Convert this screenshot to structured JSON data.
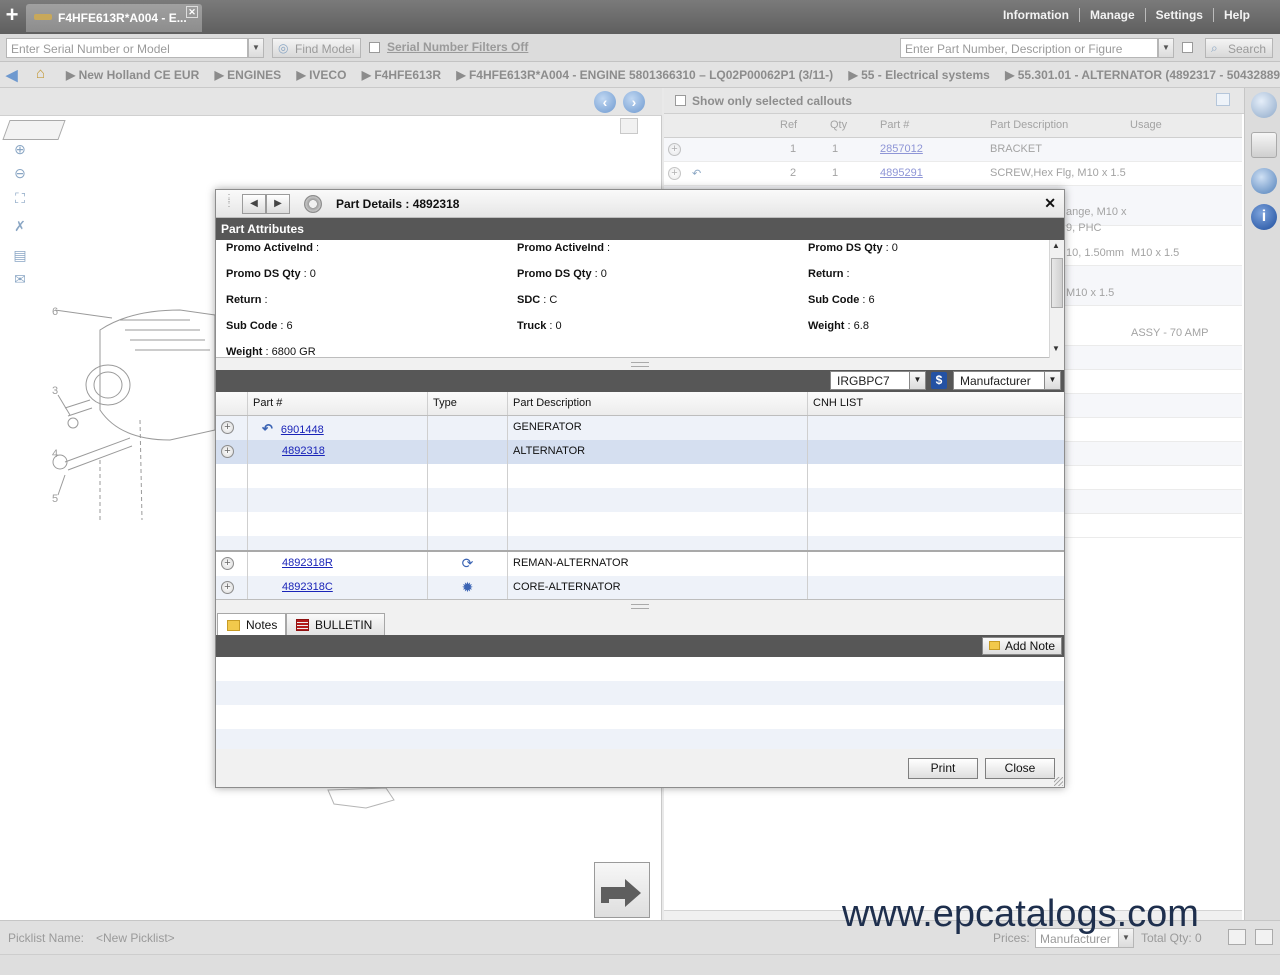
{
  "app": {
    "tab_title": "F4HFE613R*A004 - E...",
    "menu": [
      "Information",
      "Manage",
      "Settings",
      "Help"
    ]
  },
  "search": {
    "serial_placeholder": "Enter Serial Number or Model",
    "find_model": "Find Model",
    "serial_filters": "Serial Number Filters Off",
    "part_placeholder": "Enter Part Number, Description or Figure",
    "search_label": "Search"
  },
  "breadcrumb": [
    "New Holland CE EUR",
    "ENGINES",
    "IVECO",
    "F4HFE613R",
    "F4HFE613R*A004 - ENGINE 5801366310 – LQ02P00062P1 (3/11-)",
    "55 - Electrical systems",
    "55.301.01 - ALTERNATOR (4892317 - 504328894)"
  ],
  "diagram": {
    "callouts": [
      "6",
      "3",
      "4",
      "5"
    ]
  },
  "callout_panel": {
    "show_only_selected": "Show only selected callouts",
    "columns": [
      "Ref",
      "Qty",
      "Part #",
      "Part Description",
      "Usage"
    ],
    "rows": [
      {
        "ref": "1",
        "qty": "1",
        "part": "2857012",
        "desc": "BRACKET",
        "usage": ""
      },
      {
        "ref": "2",
        "qty": "1",
        "part": "4895291",
        "desc": "SCREW,Hex Flg, M10 x 1.5",
        "usage": ""
      }
    ],
    "fragments": [
      "ange, M10 x",
      "9, PHC",
      "10, 1.50mm",
      "M10 x 1.5",
      "M10 x 1.5",
      "ASSY - 70 AMP"
    ]
  },
  "picklist": {
    "label": "Picklist Name:",
    "value": "<New Picklist>",
    "prices_label": "Prices:",
    "prices_value": "Manufacturer",
    "total_qty": "Total Qty: 0"
  },
  "watermark": "www.epcatalogs.com",
  "modal": {
    "title": "Part Details : 4892318",
    "attributes_header": "Part Attributes",
    "attributes": [
      {
        "label": "Promo ActiveInd",
        "value": ""
      },
      {
        "label": "Promo ActiveInd",
        "value": ""
      },
      {
        "label": "Promo DS Qty",
        "value": "0"
      },
      {
        "label": "Promo DS Qty",
        "value": "0"
      },
      {
        "label": "Promo DS Qty",
        "value": "0"
      },
      {
        "label": "Return",
        "value": ""
      },
      {
        "label": "Return",
        "value": ""
      },
      {
        "label": "SDC",
        "value": "C"
      },
      {
        "label": "Sub Code",
        "value": "6"
      },
      {
        "label": "Sub Code",
        "value": "6"
      },
      {
        "label": "Truck",
        "value": "0"
      },
      {
        "label": "Weight",
        "value": "6.8"
      },
      {
        "label": "Weight",
        "value": "6800 GR"
      }
    ],
    "price_code": "IRGBPC7",
    "dollar_icon": "$",
    "price_type": "Manufacturer",
    "table_columns": [
      "Part #",
      "Type",
      "Part Description",
      "CNH LIST"
    ],
    "parts": [
      {
        "part": "6901448",
        "type": "",
        "desc": "GENERATOR",
        "list": ""
      },
      {
        "part": "4892318",
        "type": "",
        "desc": "ALTERNATOR",
        "list": ""
      }
    ],
    "alternates": [
      {
        "part": "4892318R",
        "type_icon": "reman-icon",
        "desc": "REMAN-ALTERNATOR",
        "list": ""
      },
      {
        "part": "4892318C",
        "type_icon": "core-gear-icon",
        "desc": "CORE-ALTERNATOR",
        "list": ""
      }
    ],
    "tabs": [
      "Notes",
      "BULLETIN"
    ],
    "add_note": "Add Note",
    "print": "Print",
    "close": "Close"
  }
}
